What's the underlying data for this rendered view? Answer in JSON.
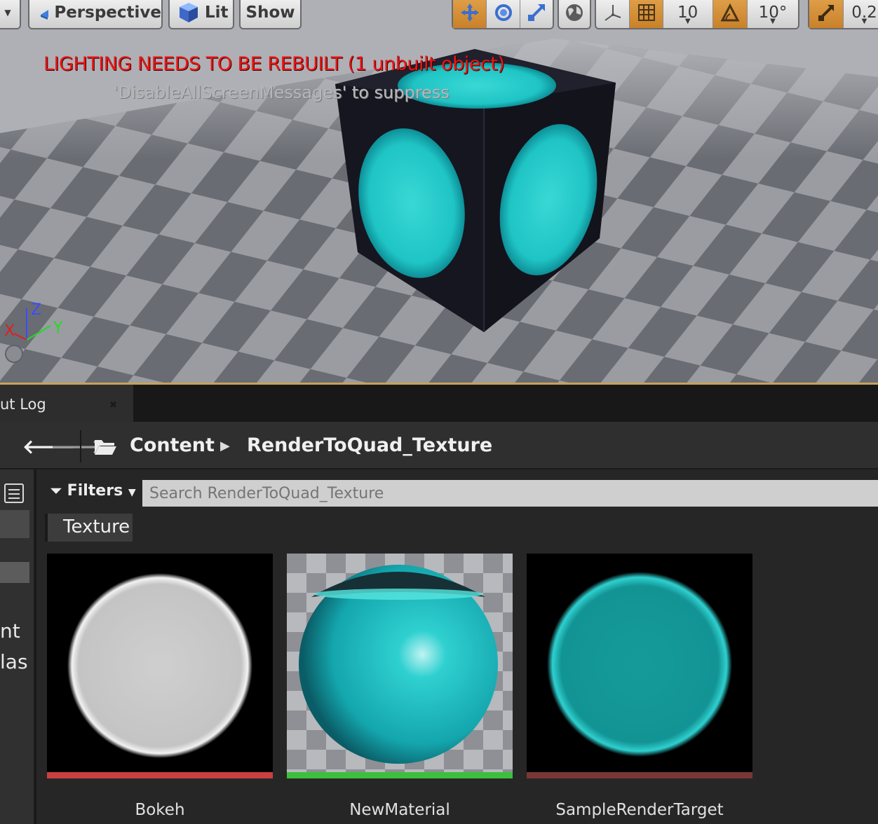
{
  "toolbar": {
    "perspective_label": "Perspective",
    "lit_label": "Lit",
    "show_label": "Show",
    "grid_snap_value": "10",
    "rotation_snap_value": "10°",
    "scale_snap_value": "0.2"
  },
  "viewport_messages": {
    "warning": "LIGHTING NEEDS TO BE REBUILT (1 unbuilt object)",
    "hint": "'DisableAllScreenMessages' to suppress"
  },
  "axes": {
    "x": "X",
    "y": "Y",
    "z": "Z"
  },
  "tabs": {
    "output_log_partial": "ut Log"
  },
  "breadcrumb": {
    "root": "Content",
    "folder": "RenderToQuad_Texture"
  },
  "filters": {
    "label": "Filters"
  },
  "search": {
    "placeholder": "Search RenderToQuad_Texture"
  },
  "filter_chip": {
    "label": "Texture"
  },
  "sidebar": {
    "partial_lines": [
      "nt",
      "las"
    ]
  },
  "assets": [
    {
      "name": "Bokeh",
      "type_color": "#c94040"
    },
    {
      "name": "NewMaterial",
      "type_color": "#3cbf3c"
    },
    {
      "name": "SampleRenderTarget",
      "type_color": "#7a3636"
    }
  ],
  "colors": {
    "accent_orange": "#c98129",
    "teal": "#2fd0d0",
    "warning_red": "#e81616"
  }
}
